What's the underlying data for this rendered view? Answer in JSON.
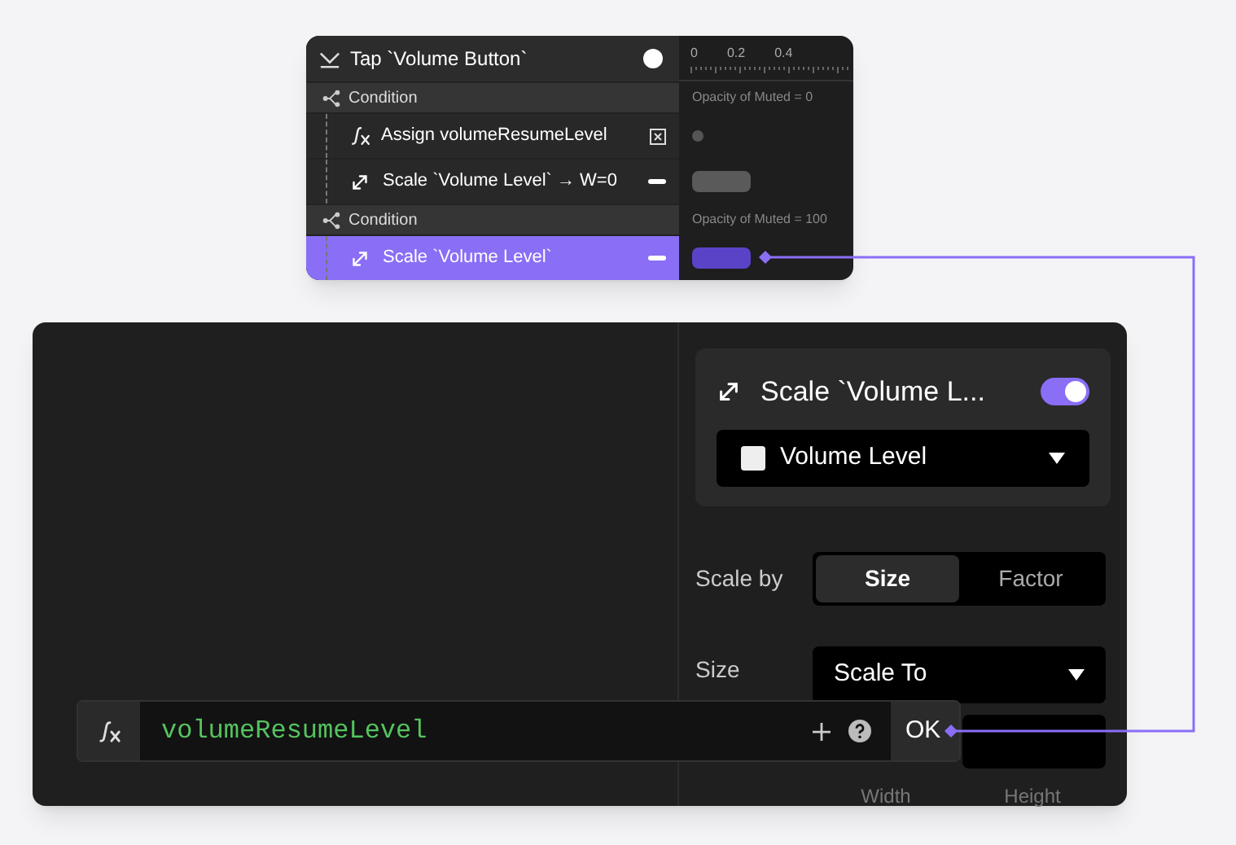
{
  "sequence": {
    "title": "Tap `Volume Button`",
    "recording": true,
    "ticks": [
      "0",
      "0.2",
      "0.4"
    ],
    "rows": [
      {
        "kind": "condition",
        "label": "Condition",
        "lane": {
          "kind": "label",
          "text": "Opacity of Muted = 0"
        }
      },
      {
        "kind": "assign",
        "label": "Assign volumeResumeLevel",
        "selected": false,
        "lane": {
          "kind": "dot"
        }
      },
      {
        "kind": "scale",
        "label": "Scale `Volume Level` → W=0",
        "selected": false,
        "lane": {
          "kind": "bar"
        }
      },
      {
        "kind": "condition",
        "label": "Condition",
        "lane": {
          "kind": "label",
          "text": "Opacity of Muted = 100"
        }
      },
      {
        "kind": "scale",
        "label": "Scale `Volume Level`",
        "selected": true,
        "lane": {
          "kind": "bar"
        }
      }
    ]
  },
  "inspector": {
    "title": "Scale `Volume L...",
    "enabled": true,
    "layer": "Volume Level",
    "scale_by": {
      "label": "Scale by",
      "options": [
        {
          "label": "Size",
          "selected": true
        },
        {
          "label": "Factor",
          "selected": false
        }
      ]
    },
    "size": {
      "label": "Size",
      "value": "Scale To"
    },
    "fields": [
      "Width",
      "Height"
    ]
  },
  "formula": {
    "value": "volumeResumeLevel",
    "ok": "OK"
  }
}
